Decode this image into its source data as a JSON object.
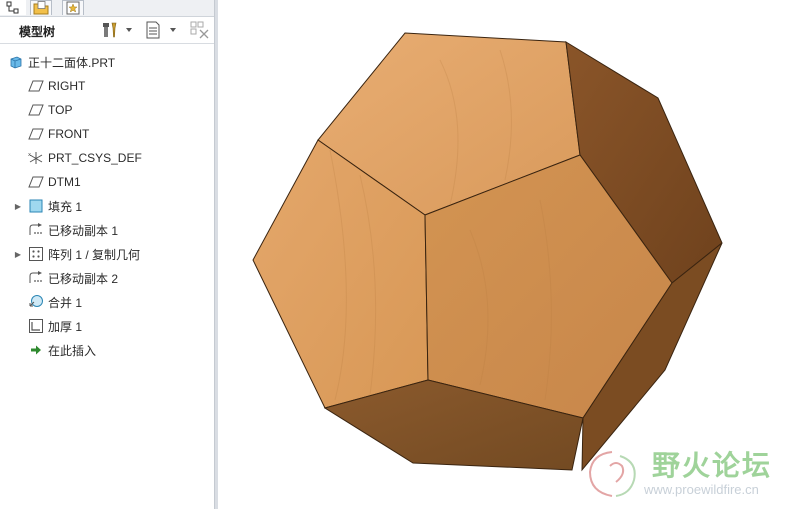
{
  "panel": {
    "title": "模型树",
    "tabs": [
      {
        "icon": "model-tree-tab-icon"
      },
      {
        "icon": "folder-browser-tab-icon"
      },
      {
        "icon": "favorites-tab-icon"
      }
    ],
    "toolbar": [
      {
        "icon": "settings-tools-icon"
      },
      {
        "icon": "show-columns-icon"
      },
      {
        "icon": "filter-icon"
      }
    ]
  },
  "tree": {
    "items": [
      {
        "label": "正十二面体.PRT",
        "icon": "part-icon"
      },
      {
        "label": "RIGHT",
        "icon": "datum-plane-icon"
      },
      {
        "label": "TOP",
        "icon": "datum-plane-icon"
      },
      {
        "label": "FRONT",
        "icon": "datum-plane-icon"
      },
      {
        "label": "PRT_CSYS_DEF",
        "icon": "coordinate-system-icon"
      },
      {
        "label": "DTM1",
        "icon": "datum-plane-icon"
      },
      {
        "label": "填充 1",
        "icon": "fill-icon",
        "expandable": true
      },
      {
        "label": "已移动副本 1",
        "icon": "moved-copy-icon"
      },
      {
        "label": "阵列 1 / 复制几何",
        "icon": "pattern-icon",
        "expandable": true
      },
      {
        "label": "已移动副本 2",
        "icon": "moved-copy-icon"
      },
      {
        "label": "合并 1",
        "icon": "merge-icon"
      },
      {
        "label": "加厚 1",
        "icon": "thicken-icon"
      },
      {
        "label": "在此插入",
        "icon": "insert-here-arrow-icon"
      }
    ]
  },
  "watermark": {
    "title": "野火论坛",
    "url": "www.proewildfire.cn"
  },
  "colors": {
    "wood_light": "#e2a66a",
    "wood_mid": "#cf8f52",
    "wood_dark": "#7e4f25",
    "watermark_green": "#9fd39a"
  }
}
